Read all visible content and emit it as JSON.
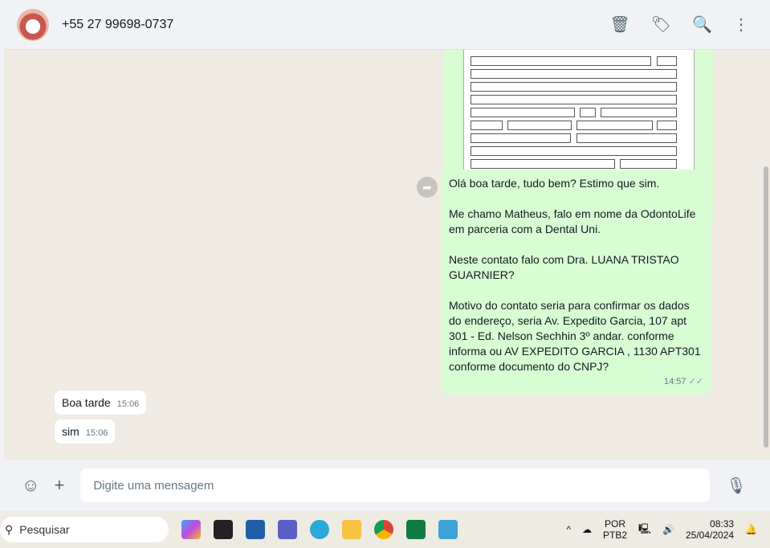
{
  "header": {
    "contact": "+55 27 99698-0737"
  },
  "messages": {
    "outgoing": {
      "text": "Olá boa tarde, tudo bem? Estimo que sim.\n\nMe chamo Matheus, falo em nome da OdontoLife em parceria com a Dental Uni.\n\nNeste contato falo com Dra. LUANA TRISTAO GUARNIER?\n\nMotivo do contato seria para confirmar os dados do endereço, seria Av. Expedito Garcia, 107 apt 301 - Ed. Nelson Sechhin 3º andar. conforme informa ou AV EXPEDITO GARCIA , 1130 APT301 conforme documento do CNPJ?",
      "time": "14:57"
    },
    "incoming": [
      {
        "text": "Boa tarde",
        "time": "15:06"
      },
      {
        "text": "sim",
        "time": "15:06"
      }
    ]
  },
  "footer": {
    "placeholder": "Digite uma mensagem"
  },
  "taskbar": {
    "search": "Pesquisar",
    "lang1": "POR",
    "lang2": "PTB2",
    "time": "08:33",
    "date": "25/04/2024"
  }
}
